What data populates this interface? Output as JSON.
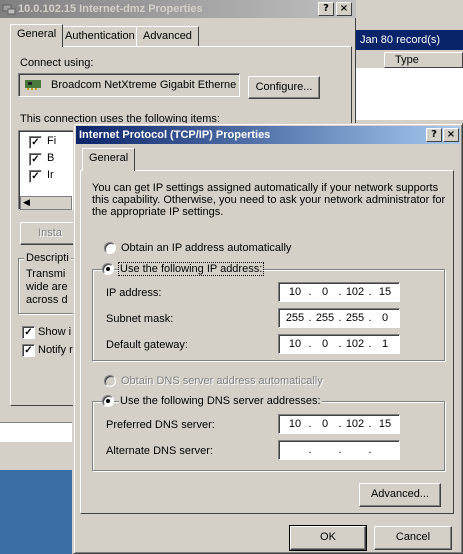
{
  "bg_window": {
    "title": "10.0.102.15 Internet-dmz Properties",
    "help_glyph": "?",
    "close_glyph": "×",
    "tabs": [
      "General",
      "Authentication",
      "Advanced"
    ],
    "connect_using_label": "Connect using:",
    "adapter_name": "Broadcom NetXtreme Gigabit Etherne",
    "configure_label": "Configure...",
    "components_label": "This connection uses the following items:",
    "component_items": [
      "Fi",
      "B",
      "Ir"
    ],
    "install_label": "Insta",
    "description_label": "Descripti",
    "description_lines": [
      "Transmi",
      "wide are",
      "across d"
    ],
    "show_icon_label": "Show i",
    "notify_label": "Notify r"
  },
  "list_window": {
    "header_text": "Jan  80 record(s)",
    "column_type": "Type"
  },
  "dialog": {
    "title": "Internet Protocol (TCP/IP) Properties",
    "help_glyph": "?",
    "close_glyph": "×",
    "tab_general": "General",
    "intro_text": "You can get IP settings assigned automatically if your network supports this capability. Otherwise, you need to ask your network administrator for the appropriate IP settings.",
    "obtain_ip_auto": "Obtain an IP address automatically",
    "use_following_ip": "Use the following IP address:",
    "ip_address_label": "IP address:",
    "ip_address": [
      "10",
      "0",
      "102",
      "15"
    ],
    "subnet_mask_label": "Subnet mask:",
    "subnet_mask": [
      "255",
      "255",
      "255",
      "0"
    ],
    "gateway_label": "Default gateway:",
    "gateway": [
      "10",
      "0",
      "102",
      "1"
    ],
    "obtain_dns_auto": "Obtain DNS server address automatically",
    "use_following_dns": "Use the following DNS server addresses:",
    "preferred_dns_label": "Preferred DNS server:",
    "preferred_dns": [
      "10",
      "0",
      "102",
      "15"
    ],
    "alternate_dns_label": "Alternate DNS server:",
    "alternate_dns": [
      "",
      "",
      "",
      ""
    ],
    "advanced_label": "Advanced...",
    "ok_label": "OK",
    "cancel_label": "Cancel"
  }
}
